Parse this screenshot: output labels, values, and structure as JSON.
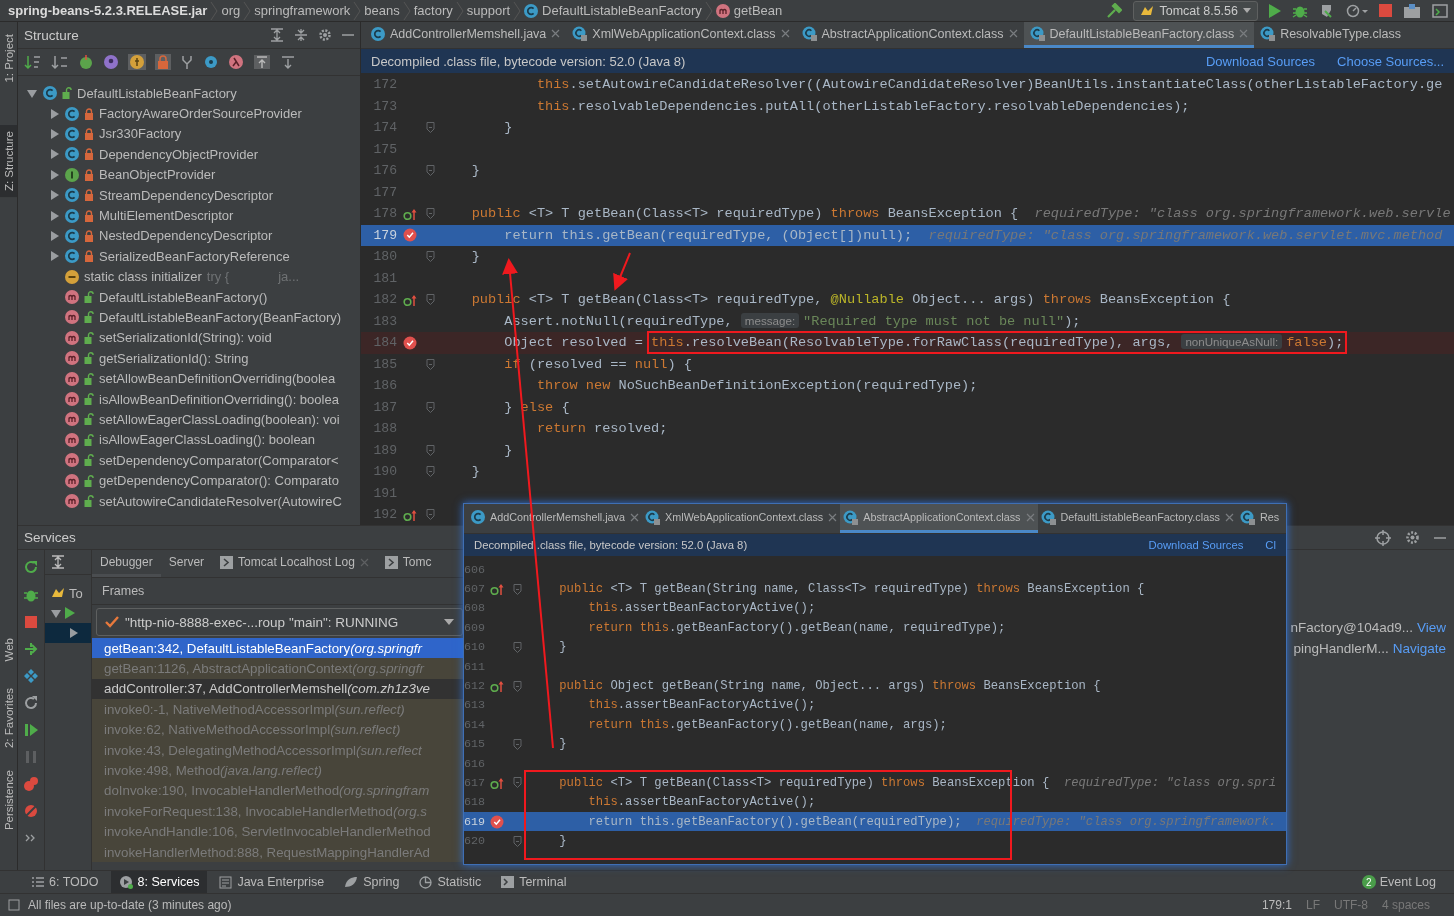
{
  "navbar": {
    "breadcrumbs": [
      {
        "label": "spring-beans-5.2.3.RELEASE.jar",
        "kind": "jar"
      },
      {
        "label": "org",
        "kind": "package"
      },
      {
        "label": "springframework",
        "kind": "package"
      },
      {
        "label": "beans",
        "kind": "package"
      },
      {
        "label": "factory",
        "kind": "package"
      },
      {
        "label": "support",
        "kind": "package"
      },
      {
        "label": "DefaultListableBeanFactory",
        "kind": "class"
      },
      {
        "label": "getBean",
        "kind": "method"
      }
    ],
    "run_config": "Tomcat 8.5.56"
  },
  "side_strip": {
    "top": [
      {
        "label": "1: Project",
        "selected": false
      },
      {
        "label": "Z: Structure",
        "selected": true
      }
    ],
    "bottom": [
      {
        "label": "Web",
        "selected": false
      },
      {
        "label": "2: Favorites",
        "selected": false
      },
      {
        "label": "Persistence",
        "selected": false
      }
    ]
  },
  "structure": {
    "title": "Structure",
    "tree": [
      {
        "label": "DefaultListableBeanFactory",
        "kind": "class",
        "private": false,
        "expanded": true,
        "children": [
          {
            "label": "FactoryAwareOrderSourceProvider",
            "kind": "class",
            "private": true,
            "expanded": false
          },
          {
            "label": "Jsr330Factory",
            "kind": "class",
            "private": true,
            "expanded": false
          },
          {
            "label": "DependencyObjectProvider",
            "kind": "class",
            "private": true,
            "expanded": false
          },
          {
            "label": "BeanObjectProvider",
            "kind": "interface",
            "private": true,
            "expanded": false
          },
          {
            "label": "StreamDependencyDescriptor",
            "kind": "class",
            "private": true,
            "expanded": false
          },
          {
            "label": "MultiElementDescriptor",
            "kind": "class",
            "private": true,
            "expanded": false
          },
          {
            "label": "NestedDependencyDescriptor",
            "kind": "class",
            "private": true,
            "expanded": false
          },
          {
            "label": "SerializedBeanFactoryReference",
            "kind": "class",
            "private": true,
            "expanded": false
          },
          {
            "label": "static class initializer",
            "kind": "initializer",
            "details": [
              "try {",
              "ja..."
            ]
          },
          {
            "label": "DefaultListableBeanFactory()",
            "kind": "method",
            "private": false
          },
          {
            "label": "DefaultListableBeanFactory(BeanFactory)",
            "kind": "method",
            "private": false
          },
          {
            "label": "setSerializationId(String): void",
            "kind": "method",
            "private": false
          },
          {
            "label": "getSerializationId(): String",
            "kind": "method",
            "private": false
          },
          {
            "label": "setAllowBeanDefinitionOverriding(boolea",
            "kind": "method",
            "private": false
          },
          {
            "label": "isAllowBeanDefinitionOverriding(): boolea",
            "kind": "method",
            "private": false
          },
          {
            "label": "setAllowEagerClassLoading(boolean): voi",
            "kind": "method",
            "private": false
          },
          {
            "label": "isAllowEagerClassLoading(): boolean",
            "kind": "method",
            "private": false
          },
          {
            "label": "setDependencyComparator(Comparator<",
            "kind": "method",
            "private": false
          },
          {
            "label": "getDependencyComparator(): Comparato",
            "kind": "method",
            "private": false
          },
          {
            "label": "setAutowireCandidateResolver(AutowireC",
            "kind": "method",
            "private": false
          }
        ]
      }
    ]
  },
  "editor": {
    "tabs": [
      {
        "label": "AddControllerMemshell.java",
        "kind": "java",
        "selected": false
      },
      {
        "label": "XmlWebApplicationContext.class",
        "kind": "class",
        "selected": false
      },
      {
        "label": "AbstractApplicationContext.class",
        "kind": "class",
        "selected": false
      },
      {
        "label": "DefaultListableBeanFactory.class",
        "kind": "class",
        "selected": true
      },
      {
        "label": "ResolvableType.class",
        "kind": "class",
        "selected": false
      }
    ],
    "banner": {
      "text": "Decompiled .class file, bytecode version: 52.0 (Java 8)",
      "links": [
        "Download Sources",
        "Choose Sources..."
      ]
    },
    "lines": [
      {
        "n": "172",
        "fold": false,
        "override": false,
        "breakpoint": false,
        "current": false,
        "tokens": [
          {
            "kind": "keyword",
            "text": "            this"
          },
          {
            "kind": "plain",
            "text": ".setAutowireCandidateResolver((AutowireCandidateResolver)BeanUtils.instantiateClass(otherListableFactory.ge"
          }
        ]
      },
      {
        "n": "173",
        "fold": false,
        "override": false,
        "breakpoint": false,
        "current": false,
        "tokens": [
          {
            "kind": "keyword",
            "text": "            this"
          },
          {
            "kind": "plain",
            "text": ".resolvableDependencies.putAll(otherListableFactory.resolvableDependencies);"
          }
        ]
      },
      {
        "n": "174",
        "fold": true,
        "override": false,
        "breakpoint": false,
        "current": false,
        "tokens": [
          {
            "kind": "plain",
            "text": "        }"
          }
        ]
      },
      {
        "n": "175",
        "fold": false,
        "override": false,
        "breakpoint": false,
        "current": false
      },
      {
        "n": "176",
        "fold": true,
        "override": false,
        "breakpoint": false,
        "current": false,
        "tokens": [
          {
            "kind": "plain",
            "text": "    }"
          }
        ]
      },
      {
        "n": "177",
        "fold": false,
        "override": false,
        "breakpoint": false,
        "current": false
      },
      {
        "n": "178",
        "fold": true,
        "override": true,
        "breakpoint": false,
        "current": false,
        "tokens": [
          {
            "kind": "keyword",
            "text": "    public "
          },
          {
            "kind": "plain",
            "text": "<T> T getBean(Class<T> requiredType) "
          },
          {
            "kind": "keyword",
            "text": "throws "
          },
          {
            "kind": "plain",
            "text": "BeansException {"
          },
          {
            "kind": "hint",
            "text": "  requiredType: \"class org.springframework.web.servle"
          }
        ]
      },
      {
        "n": "179",
        "fold": false,
        "override": false,
        "breakpoint": true,
        "current": true,
        "tokens": [
          {
            "kind": "keyword",
            "text": "        return this"
          },
          {
            "kind": "plain",
            "text": ".getBean(requiredType, (Object[])"
          },
          {
            "kind": "keyword",
            "text": "null"
          },
          {
            "kind": "plain",
            "text": ");"
          },
          {
            "kind": "hint",
            "text": "  requiredType: \"class org.springframework.web.servlet.mvc.method"
          }
        ]
      },
      {
        "n": "180",
        "fold": true,
        "override": false,
        "breakpoint": false,
        "current": false,
        "tokens": [
          {
            "kind": "plain",
            "text": "    }"
          }
        ]
      },
      {
        "n": "181",
        "fold": false,
        "override": false,
        "breakpoint": false,
        "current": false
      },
      {
        "n": "182",
        "fold": true,
        "override": true,
        "breakpoint": false,
        "current": false,
        "tokens": [
          {
            "kind": "keyword",
            "text": "    public "
          },
          {
            "kind": "plain",
            "text": "<T> T getBean(Class<T> requiredType, "
          },
          {
            "kind": "annotation",
            "text": "@Nullable "
          },
          {
            "kind": "plain",
            "text": "Object... args) "
          },
          {
            "kind": "keyword",
            "text": "throws "
          },
          {
            "kind": "plain",
            "text": "BeansException {"
          }
        ]
      },
      {
        "n": "183",
        "fold": false,
        "override": false,
        "breakpoint": false,
        "current": false,
        "tokens": [
          {
            "kind": "plain",
            "text": "        Assert.notNull(requiredType, "
          },
          {
            "kind": "param",
            "text": "message:"
          },
          {
            "kind": "string",
            "text": "\"Required type must not be null\""
          },
          {
            "kind": "plain",
            "text": ");"
          }
        ]
      },
      {
        "n": "184",
        "fold": false,
        "override": false,
        "breakpoint": true,
        "current": false,
        "tokens": [
          {
            "kind": "plain",
            "text": "        Object resolved = "
          }
        ],
        "boxed_tokens": [
          {
            "kind": "keyword",
            "text": "this"
          },
          {
            "kind": "plain",
            "text": ".resolveBean(ResolvableType.forRawClass(requiredType), args, "
          },
          {
            "kind": "param",
            "text": "nonUniqueAsNull:"
          },
          {
            "kind": "keyword",
            "text": "false"
          },
          {
            "kind": "plain",
            "text": ");"
          }
        ]
      },
      {
        "n": "185",
        "fold": true,
        "override": false,
        "breakpoint": false,
        "current": false,
        "tokens": [
          {
            "kind": "keyword",
            "text": "        if "
          },
          {
            "kind": "plain",
            "text": "(resolved == "
          },
          {
            "kind": "keyword",
            "text": "null"
          },
          {
            "kind": "plain",
            "text": ") {"
          }
        ]
      },
      {
        "n": "186",
        "fold": false,
        "override": false,
        "breakpoint": false,
        "current": false,
        "tokens": [
          {
            "kind": "keyword",
            "text": "            throw new "
          },
          {
            "kind": "plain",
            "text": "NoSuchBeanDefinitionException(requiredType);"
          }
        ]
      },
      {
        "n": "187",
        "fold": true,
        "override": false,
        "breakpoint": false,
        "current": false,
        "tokens": [
          {
            "kind": "plain",
            "text": "        } "
          },
          {
            "kind": "keyword",
            "text": "else "
          },
          {
            "kind": "plain",
            "text": "{"
          }
        ]
      },
      {
        "n": "188",
        "fold": false,
        "override": false,
        "breakpoint": false,
        "current": false,
        "tokens": [
          {
            "kind": "keyword",
            "text": "            return "
          },
          {
            "kind": "plain",
            "text": "resolved;"
          }
        ]
      },
      {
        "n": "189",
        "fold": true,
        "override": false,
        "breakpoint": false,
        "current": false,
        "tokens": [
          {
            "kind": "plain",
            "text": "        }"
          }
        ]
      },
      {
        "n": "190",
        "fold": true,
        "override": false,
        "breakpoint": false,
        "current": false,
        "tokens": [
          {
            "kind": "plain",
            "text": "    }"
          }
        ]
      },
      {
        "n": "191",
        "fold": false,
        "override": false,
        "breakpoint": false,
        "current": false
      },
      {
        "n": "192",
        "fold": true,
        "override": true,
        "breakpoint": false,
        "current": false
      }
    ]
  },
  "services": {
    "title": "Services",
    "tree_label": "To",
    "tabs": [
      {
        "label": "Debugger",
        "kind": "plain",
        "selected": true,
        "closable": false
      },
      {
        "label": "Server",
        "kind": "plain",
        "selected": false,
        "closable": false
      },
      {
        "label": "Tomcat Localhost Log",
        "kind": "log",
        "selected": false,
        "closable": true
      },
      {
        "label": "Tomc",
        "kind": "log",
        "selected": false,
        "closable": false
      }
    ],
    "frames_label": "Frames",
    "thread": "\"http-nio-8888-exec-...roup \"main\": RUNNING",
    "frames": [
      {
        "method": "getBean:342, DefaultListableBeanFactory",
        "package": "(org.springfr",
        "selected": true,
        "library": false
      },
      {
        "method": "getBean:1126, AbstractApplicationContext",
        "package": "(org.springfr",
        "selected": false,
        "library": true
      },
      {
        "method": "addController:37, AddControllerMemshell",
        "package": "(com.zh1z3ve",
        "selected": false,
        "library": false
      },
      {
        "method": "invoke0:-1, NativeMethodAccessorImpl",
        "package": "(sun.reflect)",
        "selected": false,
        "library": true
      },
      {
        "method": "invoke:62, NativeMethodAccessorImpl",
        "package": "(sun.reflect)",
        "selected": false,
        "library": true
      },
      {
        "method": "invoke:43, DelegatingMethodAccessorImpl",
        "package": "(sun.reflect",
        "selected": false,
        "library": true
      },
      {
        "method": "invoke:498, Method",
        "package": "(java.lang.reflect)",
        "selected": false,
        "library": true
      },
      {
        "method": "doInvoke:190, InvocableHandlerMethod",
        "package": "(org.springfram",
        "selected": false,
        "library": true
      },
      {
        "method": "invokeForRequest:138, InvocableHandlerMethod",
        "package": "(org.s",
        "selected": false,
        "library": true
      },
      {
        "method": "invokeAndHandle:106, ServletInvocableHandlerMethod",
        "selected": false,
        "library": true
      },
      {
        "method": "invokeHandlerMethod:888, RequestMappingHandlerAd",
        "selected": false,
        "library": true
      }
    ],
    "variables": [
      {
        "text": "nFactory@104ad9...",
        "link": "View"
      },
      {
        "text": "pingHandlerM...",
        "link": "Navigate"
      }
    ]
  },
  "popup": {
    "tabs": [
      {
        "label": "AddControllerMemshell.java",
        "kind": "java",
        "selected": false
      },
      {
        "label": "XmlWebApplicationContext.class",
        "kind": "class",
        "selected": false
      },
      {
        "label": "AbstractApplicationContext.class",
        "kind": "class",
        "selected": true
      },
      {
        "label": "DefaultListableBeanFactory.class",
        "kind": "class",
        "selected": false
      },
      {
        "label": "Res",
        "kind": "class",
        "selected": false
      }
    ],
    "banner": {
      "text": "Decompiled .class file, bytecode version: 52.0 (Java 8)",
      "links": [
        "Download Sources",
        "Cl"
      ]
    },
    "lines": [
      {
        "n": "606",
        "fold": false,
        "override": false,
        "breakpoint": false,
        "current": false,
        "boxed": false
      },
      {
        "n": "607",
        "fold": true,
        "override": true,
        "breakpoint": false,
        "current": false,
        "boxed": false,
        "tokens": [
          {
            "kind": "keyword",
            "text": "    public "
          },
          {
            "kind": "plain",
            "text": "<T> T getBean(String name, Class<T> requiredType) "
          },
          {
            "kind": "keyword",
            "text": "throws "
          },
          {
            "kind": "plain",
            "text": "BeansException {"
          }
        ]
      },
      {
        "n": "608",
        "fold": false,
        "override": false,
        "breakpoint": false,
        "current": false,
        "boxed": false,
        "tokens": [
          {
            "kind": "keyword",
            "text": "        this"
          },
          {
            "kind": "plain",
            "text": ".assertBeanFactoryActive();"
          }
        ]
      },
      {
        "n": "609",
        "fold": false,
        "override": false,
        "breakpoint": false,
        "current": false,
        "boxed": false,
        "tokens": [
          {
            "kind": "keyword",
            "text": "        return this"
          },
          {
            "kind": "plain",
            "text": ".getBeanFactory().getBean(name, requiredType);"
          }
        ]
      },
      {
        "n": "610",
        "fold": true,
        "override": false,
        "breakpoint": false,
        "current": false,
        "boxed": false,
        "tokens": [
          {
            "kind": "plain",
            "text": "    }"
          }
        ]
      },
      {
        "n": "611",
        "fold": false,
        "override": false,
        "breakpoint": false,
        "current": false,
        "boxed": false
      },
      {
        "n": "612",
        "fold": true,
        "override": true,
        "breakpoint": false,
        "current": false,
        "boxed": false,
        "tokens": [
          {
            "kind": "keyword",
            "text": "    public "
          },
          {
            "kind": "plain",
            "text": "Object getBean(String name, Object... args) "
          },
          {
            "kind": "keyword",
            "text": "throws "
          },
          {
            "kind": "plain",
            "text": "BeansException {"
          }
        ]
      },
      {
        "n": "613",
        "fold": false,
        "override": false,
        "breakpoint": false,
        "current": false,
        "boxed": false,
        "tokens": [
          {
            "kind": "keyword",
            "text": "        this"
          },
          {
            "kind": "plain",
            "text": ".assertBeanFactoryActive();"
          }
        ]
      },
      {
        "n": "614",
        "fold": false,
        "override": false,
        "breakpoint": false,
        "current": false,
        "boxed": false,
        "tokens": [
          {
            "kind": "keyword",
            "text": "        return this"
          },
          {
            "kind": "plain",
            "text": ".getBeanFactory().getBean(name, args);"
          }
        ]
      },
      {
        "n": "615",
        "fold": true,
        "override": false,
        "breakpoint": false,
        "current": false,
        "boxed": false,
        "tokens": [
          {
            "kind": "plain",
            "text": "    }"
          }
        ]
      },
      {
        "n": "616",
        "fold": false,
        "override": false,
        "breakpoint": false,
        "current": false,
        "boxed": false
      },
      {
        "n": "617",
        "fold": true,
        "override": true,
        "breakpoint": false,
        "current": false,
        "boxed": true,
        "tokens": [
          {
            "kind": "keyword",
            "text": "    public "
          },
          {
            "kind": "plain",
            "text": "<T> T getBean(Class<T> requiredType) "
          },
          {
            "kind": "keyword",
            "text": "throws "
          },
          {
            "kind": "plain",
            "text": "BeansException {"
          },
          {
            "kind": "hint",
            "text": "  requiredType: \"class org.spri"
          }
        ]
      },
      {
        "n": "618",
        "fold": false,
        "override": false,
        "breakpoint": false,
        "current": false,
        "boxed": true,
        "tokens": [
          {
            "kind": "keyword",
            "text": "        this"
          },
          {
            "kind": "plain",
            "text": ".assertBeanFactoryActive();"
          }
        ]
      },
      {
        "n": "619",
        "fold": false,
        "override": false,
        "breakpoint": true,
        "current": true,
        "boxed": true,
        "tokens": [
          {
            "kind": "keyword",
            "text": "        return this"
          },
          {
            "kind": "plain",
            "text": ".getBeanFactory().getBean(requiredType);"
          },
          {
            "kind": "hint",
            "text": "  requiredType: \"class org.springframework."
          }
        ]
      },
      {
        "n": "620",
        "fold": true,
        "override": false,
        "breakpoint": false,
        "current": false,
        "boxed": true,
        "tokens": [
          {
            "kind": "plain",
            "text": "    }"
          }
        ]
      }
    ]
  },
  "tool_windows": {
    "items": [
      {
        "label": "6: TODO",
        "kind": "todo",
        "selected": false
      },
      {
        "label": "8: Services",
        "kind": "services",
        "selected": true
      },
      {
        "label": "Java Enterprise",
        "kind": "enterprise",
        "selected": false
      },
      {
        "label": "Spring",
        "kind": "spring",
        "selected": false
      },
      {
        "label": "Statistic",
        "kind": "statistic",
        "selected": false
      },
      {
        "label": "Terminal",
        "kind": "terminal",
        "selected": false
      }
    ],
    "event_log": {
      "label": "Event Log",
      "count": "2"
    }
  },
  "status_bar": {
    "message": "All files are up-to-date (3 minutes ago)",
    "position": "179:1",
    "line_separator": "LF",
    "encoding": "UTF-8",
    "indent": "4 spaces"
  }
}
